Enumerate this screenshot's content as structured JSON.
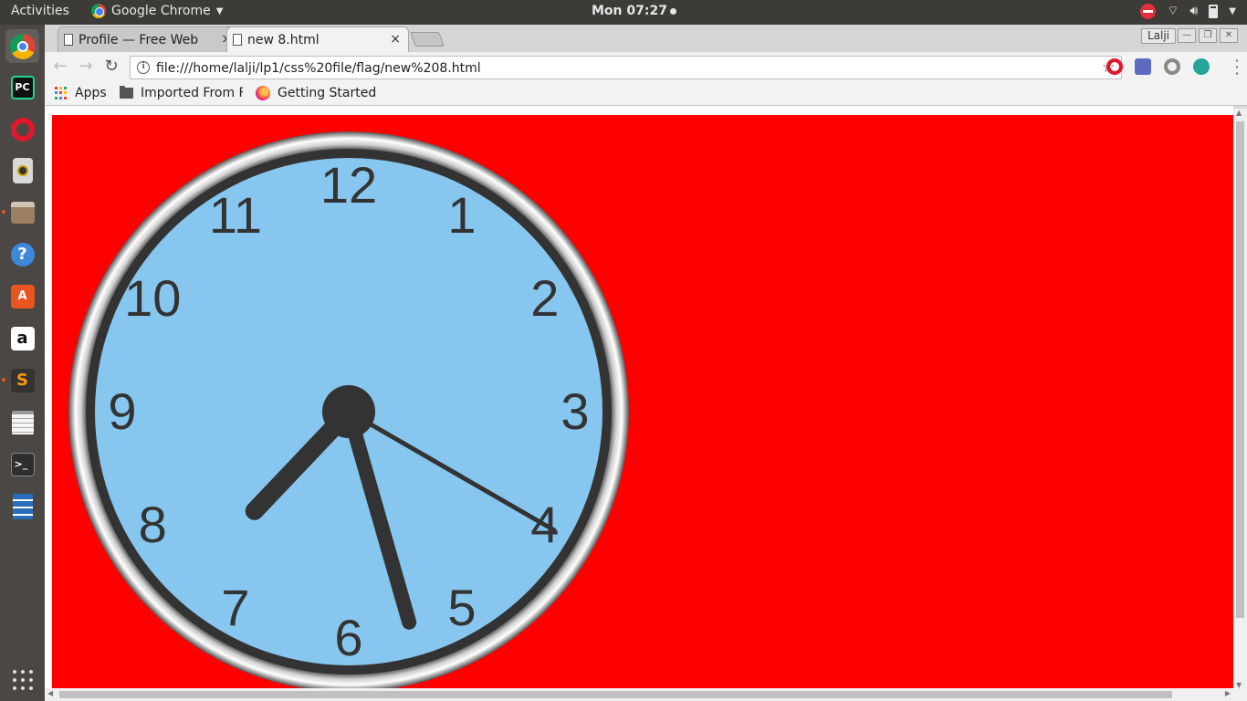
{
  "topbar": {
    "activities": "Activities",
    "app_name": "Google Chrome",
    "clock": "Mon 07:27"
  },
  "dock": {
    "items": [
      {
        "name": "chrome",
        "color": "#ffffff"
      },
      {
        "name": "pycharm",
        "color": "#21d789"
      },
      {
        "name": "opera",
        "color": "#e0182d"
      },
      {
        "name": "speaker",
        "color": "#d8d8d8"
      },
      {
        "name": "files",
        "color": "#9b7f62"
      },
      {
        "name": "help",
        "color": "#3c88d9"
      },
      {
        "name": "software-store",
        "color": "#e95420"
      },
      {
        "name": "amazon",
        "color": "#ffffff"
      },
      {
        "name": "sublime",
        "color": "#ff9800"
      },
      {
        "name": "text-editor",
        "color": "#f5f5f5"
      },
      {
        "name": "terminal",
        "color": "#2e2e2e"
      },
      {
        "name": "writer",
        "color": "#2a6ebb"
      }
    ]
  },
  "tabs": [
    {
      "title": "Profile — Free Web",
      "close": "×",
      "active": false
    },
    {
      "title": "new 8.html",
      "close": "×",
      "active": true
    }
  ],
  "profile_name": "Lalji",
  "window_controls": {
    "minimize": "—",
    "restore": "❐",
    "close": "✕"
  },
  "toolbar": {
    "back": "←",
    "forward": "→",
    "reload": "↻",
    "url": "file:///home/lalji/lp1/css%20file/flag/new%208.html",
    "star": "☆"
  },
  "bookmarks": [
    {
      "label": "Apps",
      "icon": "apps-grid-icon"
    },
    {
      "label": "Imported From F",
      "icon": "folder-icon"
    },
    {
      "label": "Getting Started",
      "icon": "firefox-icon"
    }
  ],
  "page": {
    "background": "#ff0000",
    "clock": {
      "face_color": "#87c6ee",
      "frame_color": "#333333",
      "numbers": [
        "12",
        "1",
        "2",
        "3",
        "4",
        "5",
        "6",
        "7",
        "8",
        "9",
        "10",
        "11"
      ],
      "time": {
        "hour": 7,
        "minute": 27,
        "second": 20
      }
    }
  }
}
